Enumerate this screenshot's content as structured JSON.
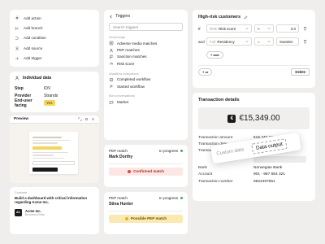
{
  "actions_menu": {
    "items": [
      {
        "label": "Add action",
        "icon": "action-icon"
      },
      {
        "label": "Add branch",
        "icon": "branch-icon"
      },
      {
        "label": "Add condition",
        "icon": "condition-icon"
      },
      {
        "label": "Add source",
        "icon": "source-icon"
      },
      {
        "label": "Add trigger",
        "icon": "trigger-icon"
      }
    ]
  },
  "individual_data": {
    "title": "Individual data",
    "rows": [
      {
        "key": "Step",
        "value": "IDV"
      },
      {
        "key": "Provider",
        "value": "Strands"
      },
      {
        "key": "End-user facing",
        "value": "Yes"
      }
    ]
  },
  "preview": {
    "title": "Preview"
  },
  "chat": {
    "label": "Conkrete",
    "message": "Build a dashboard with critical information regarding Acme Inc.",
    "company_name": "Acme Inc.",
    "company_sub": "Business Entity",
    "logo_text": "AC"
  },
  "triggers": {
    "back_label": "Triggers",
    "search_placeholder": "Search triggers",
    "sections": [
      {
        "title": "Screenings",
        "items": [
          "Adverse media matches",
          "PEP matches",
          "Sanction matches",
          "Risk score"
        ]
      },
      {
        "title": "Workflow executions",
        "items": [
          "Completed workflow",
          "Started workflow"
        ]
      },
      {
        "title": "Bot conversations",
        "items": [
          "Market"
        ]
      }
    ]
  },
  "pep_cards": [
    {
      "title": "PEP match",
      "status": "In progress",
      "name": "Mark Dorthy",
      "badge": "Confirmed match",
      "tone": "red"
    },
    {
      "title": "PEP match",
      "status": "In progress",
      "name": "Stina Hunter",
      "badge": "Possible PEP match",
      "tone": "yellow"
    }
  ],
  "risk_rule": {
    "title": "High-risk customers",
    "row1": {
      "prefix": "If",
      "field_prefix": "Risk",
      "field": "Risk score",
      "operator": ">",
      "value": "3.0"
    },
    "row2": {
      "prefix": "and",
      "field_prefix": "Full",
      "field": "Residency",
      "operator": "=",
      "value": "Sweden"
    },
    "and_label": "+ and",
    "or_label": "+ or",
    "delete_label": "Delete"
  },
  "transaction": {
    "title": "Transaction details",
    "amount": "€15,349.00",
    "currency_symbol": "€",
    "rows": [
      {
        "key": "Transaction amount",
        "value": "€15,349.00"
      },
      {
        "key": "Transaction date",
        "value": "11/04/2024"
      },
      {
        "key": "Transaction ID",
        "value": ""
      }
    ],
    "rows2": [
      {
        "key": "Bank",
        "value": "Norwegian Bank"
      },
      {
        "key": "Account",
        "value": "901 - 987 654 321"
      },
      {
        "key": "Transaction number",
        "value": "8524457651"
      }
    ]
  },
  "tooltip": {
    "option1": "Custom data",
    "option2": "Data output"
  },
  "colors": {
    "background": "#efeeec",
    "badge_red": "#fde7e4",
    "badge_yellow": "#fbe9b2",
    "status_green": "#4aa564",
    "yes_pill": "#f4d560"
  }
}
